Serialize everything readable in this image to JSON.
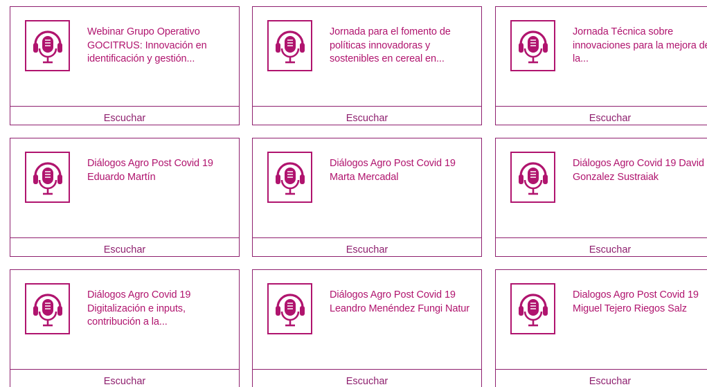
{
  "colors": {
    "accent": "#b0146e",
    "border": "#8e1f6e",
    "background": "#ffffff"
  },
  "cards": [
    {
      "title": "Webinar Grupo Operativo GOCITRUS: Innovación en identificación y gestión...",
      "action": "Escuchar",
      "icon": "podcast-microphone-headphones-icon"
    },
    {
      "title": "Jornada para el fomento de políticas innovadoras y sostenibles en cereal en...",
      "action": "Escuchar",
      "icon": "podcast-microphone-headphones-icon"
    },
    {
      "title": "Jornada Técnica sobre innovaciones para la mejora de la...",
      "action": "Escuchar",
      "icon": "podcast-microphone-headphones-icon"
    },
    {
      "title": "Diálogos Agro Post Covid 19 Eduardo Martín",
      "action": "Escuchar",
      "icon": "podcast-microphone-headphones-icon"
    },
    {
      "title": "Diálogos Agro Post Covid 19 Marta Mercadal",
      "action": "Escuchar",
      "icon": "podcast-microphone-headphones-icon"
    },
    {
      "title": "Diálogos Agro Covid 19 David Gonzalez Sustraiak",
      "action": "Escuchar",
      "icon": "podcast-microphone-headphones-icon"
    },
    {
      "title": "Diálogos Agro Covid 19 Digitalización e inputs, contribución a la...",
      "action": "Escuchar",
      "icon": "podcast-microphone-headphones-icon"
    },
    {
      "title": "Diálogos Agro Post Covid 19 Leandro Menéndez Fungi Natur",
      "action": "Escuchar",
      "icon": "podcast-microphone-headphones-icon"
    },
    {
      "title": "Dialogos Agro Post Covid 19 Miguel Tejero Riegos Salz",
      "action": "Escuchar",
      "icon": "podcast-microphone-headphones-icon"
    }
  ]
}
